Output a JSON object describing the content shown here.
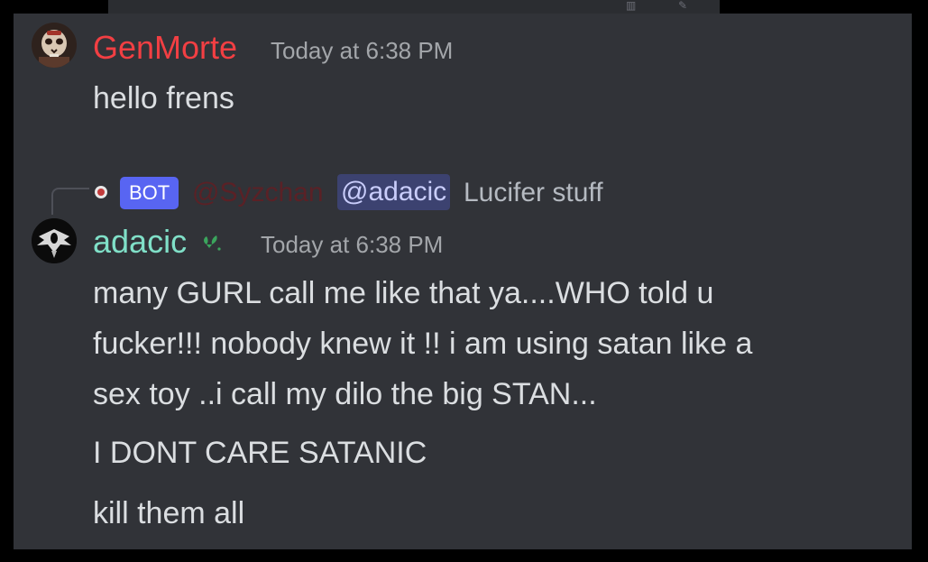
{
  "messages": [
    {
      "author": "GenMorte",
      "author_color": "#f23f43",
      "timestamp": "Today at 6:38 PM",
      "lines": [
        "hello frens"
      ]
    },
    {
      "reply": {
        "badge": "BOT",
        "author": "@Syzchan",
        "mention": "@adacic",
        "content": "Lucifer stuff"
      },
      "author": "adacic",
      "author_color": "#80e0c8",
      "timestamp": "Today at 6:38 PM",
      "lines": [
        "many GURL call me like that ya....WHO told u",
        "fucker!!! nobody knew it !! i am using satan like a",
        "sex toy ..i call my dilo the big STAN...",
        "I DONT CARE SATANIC",
        "kill them all"
      ]
    }
  ],
  "icons": {
    "avatar_1": "avatar-skull-icon",
    "avatar_2": "avatar-winged-creature-icon",
    "role": "leaf-role-icon",
    "reply_avatar": "bot-avatar-icon"
  }
}
